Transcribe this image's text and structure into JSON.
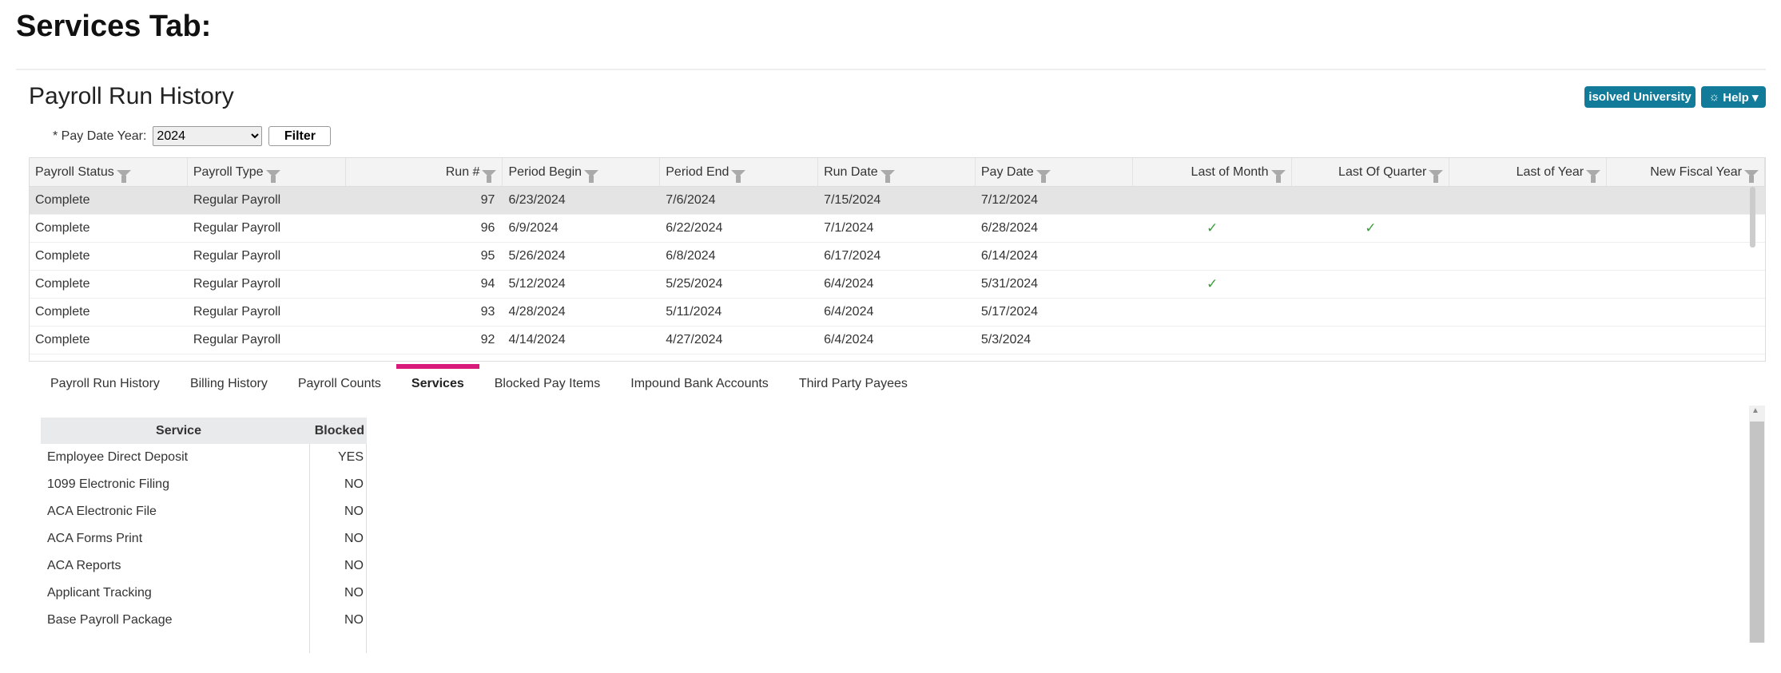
{
  "caption": "Services Tab:",
  "header": {
    "title": "Payroll Run History",
    "university_label": "isolved University",
    "help_label": "Help ▾",
    "accent": "#127b99"
  },
  "filter": {
    "label": "* Pay Date Year:",
    "value": "2024",
    "button": "Filter"
  },
  "grid": {
    "columns": [
      "Payroll Status",
      "Payroll Type",
      "Run #",
      "Period Begin",
      "Period End",
      "Run Date",
      "Pay Date",
      "Last of Month",
      "Last Of Quarter",
      "Last of Year",
      "New Fiscal Year"
    ],
    "rows": [
      [
        "Complete",
        "Regular Payroll",
        "97",
        "6/23/2024",
        "7/6/2024",
        "7/15/2024",
        "7/12/2024",
        "",
        "",
        "",
        ""
      ],
      [
        "Complete",
        "Regular Payroll",
        "96",
        "6/9/2024",
        "6/22/2024",
        "7/1/2024",
        "6/28/2024",
        "✓",
        "✓",
        "",
        ""
      ],
      [
        "Complete",
        "Regular Payroll",
        "95",
        "5/26/2024",
        "6/8/2024",
        "6/17/2024",
        "6/14/2024",
        "",
        "",
        "",
        ""
      ],
      [
        "Complete",
        "Regular Payroll",
        "94",
        "5/12/2024",
        "5/25/2024",
        "6/4/2024",
        "5/31/2024",
        "✓",
        "",
        "",
        ""
      ],
      [
        "Complete",
        "Regular Payroll",
        "93",
        "4/28/2024",
        "5/11/2024",
        "6/4/2024",
        "5/17/2024",
        "",
        "",
        "",
        ""
      ],
      [
        "Complete",
        "Regular Payroll",
        "92",
        "4/14/2024",
        "4/27/2024",
        "6/4/2024",
        "5/3/2024",
        "",
        "",
        "",
        ""
      ]
    ]
  },
  "tabs": [
    {
      "label": "Payroll Run History"
    },
    {
      "label": "Billing History"
    },
    {
      "label": "Payroll Counts"
    },
    {
      "label": "Services",
      "active": true
    },
    {
      "label": "Blocked Pay Items"
    },
    {
      "label": "Impound Bank Accounts"
    },
    {
      "label": "Third Party Payees"
    }
  ],
  "services": {
    "headers": [
      "Service",
      "Blocked"
    ],
    "rows": [
      [
        "Employee Direct Deposit",
        "YES"
      ],
      [
        "1099 Electronic Filing",
        "NO"
      ],
      [
        "ACA Electronic File",
        "NO"
      ],
      [
        "ACA Forms Print",
        "NO"
      ],
      [
        "ACA Reports",
        "NO"
      ],
      [
        "Applicant Tracking",
        "NO"
      ],
      [
        "Base Payroll Package",
        "NO"
      ]
    ]
  }
}
